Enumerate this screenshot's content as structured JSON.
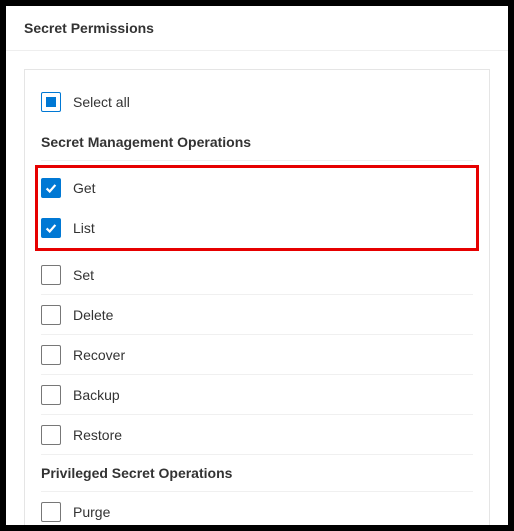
{
  "header": {
    "title": "Secret Permissions"
  },
  "selectAll": {
    "label": "Select all",
    "state": "indeterminate"
  },
  "sections": {
    "management": {
      "title": "Secret Management Operations",
      "items": {
        "get": {
          "label": "Get",
          "checked": true
        },
        "list": {
          "label": "List",
          "checked": true
        },
        "set": {
          "label": "Set",
          "checked": false
        },
        "delete": {
          "label": "Delete",
          "checked": false
        },
        "recover": {
          "label": "Recover",
          "checked": false
        },
        "backup": {
          "label": "Backup",
          "checked": false
        },
        "restore": {
          "label": "Restore",
          "checked": false
        }
      }
    },
    "privileged": {
      "title": "Privileged Secret Operations",
      "items": {
        "purge": {
          "label": "Purge",
          "checked": false
        }
      }
    }
  }
}
